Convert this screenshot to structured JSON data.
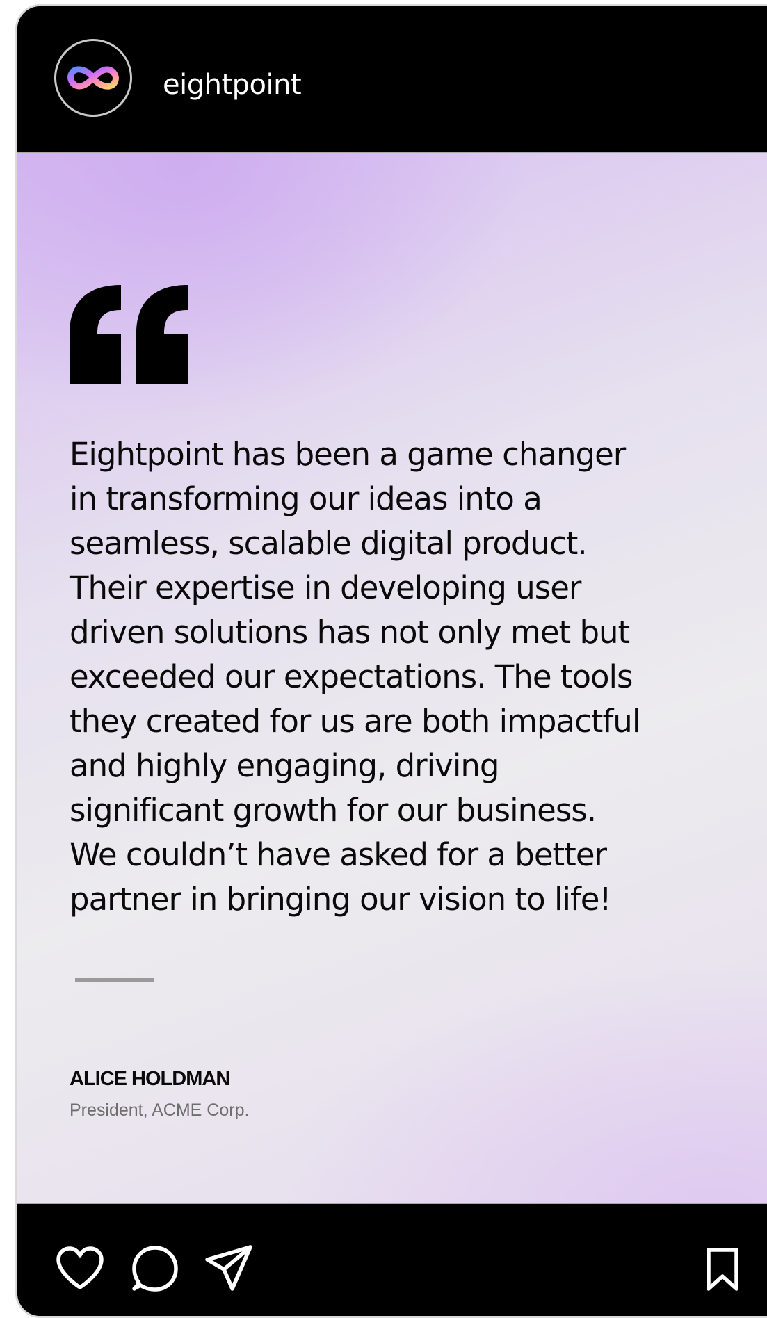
{
  "post": {
    "account": {
      "username": "eightpoint",
      "avatar_icon": "infinity-logo-icon"
    },
    "quote": {
      "mark_icon": "open-quote-icon",
      "text": "Eightpoint has been a game changer in transforming our ideas into a seamless, scalable digital product. Their expertise in developing user driven solutions has not only met but exceeded our expectations. The tools they created for us are both impactful and highly engaging, driving significant growth for our business. We couldn’t have asked for a better partner in bringing our vision to life!"
    },
    "author": {
      "name": "ALICE HOLDMAN",
      "title": "President, ACME Corp."
    },
    "actions": {
      "like_icon": "heart-icon",
      "comment_icon": "comment-icon",
      "share_icon": "send-icon",
      "save_icon": "bookmark-icon"
    }
  },
  "colors": {
    "background": "#000000",
    "card_gradient_start": "#d6bdf0",
    "card_gradient_mid": "#ecebee",
    "text": "#0a0a0a",
    "subtle_text": "#6e6e6e"
  }
}
